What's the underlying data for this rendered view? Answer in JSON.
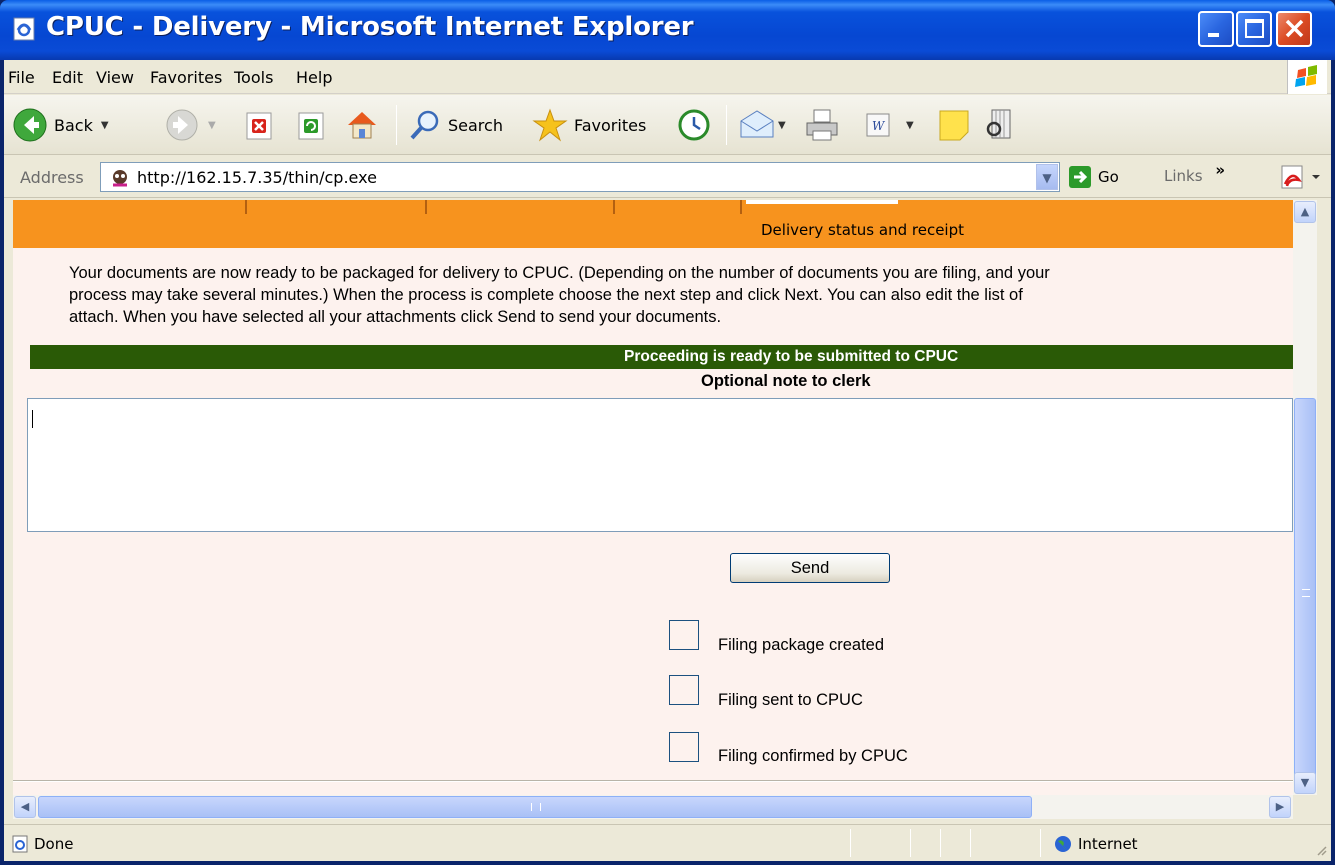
{
  "window": {
    "title": "CPUC - Delivery - Microsoft Internet Explorer"
  },
  "menu": {
    "items": [
      "File",
      "Edit",
      "View",
      "Favorites",
      "Tools",
      "Help"
    ]
  },
  "toolbar": {
    "back_label": "Back",
    "search_label": "Search",
    "favorites_label": "Favorites"
  },
  "address": {
    "label": "Address",
    "url": "http://162.15.7.35/thin/cp.exe",
    "go_label": "Go",
    "links_label": "Links"
  },
  "page": {
    "active_tab_label": "Delivery status and receipt",
    "intro_lines": [
      "Your documents are now ready to be packaged for delivery to CPUC. (Depending on the number of documents you are filing, and your",
      "process may take several minutes.) When the process is complete choose the next step and click Next. You can also edit the list of",
      "attach. When you have selected all your attachments click Send to send your documents."
    ],
    "status_banner": "Proceeding is ready to be submitted to CPUC",
    "note_label": "Optional note to clerk",
    "note_value": "",
    "send_label": "Send",
    "steps": [
      {
        "label": "Filing package created",
        "checked": false
      },
      {
        "label": "Filing sent to CPUC",
        "checked": false
      },
      {
        "label": "Filing confirmed by CPUC",
        "checked": false
      }
    ]
  },
  "status": {
    "text": "Done",
    "zone": "Internet"
  }
}
